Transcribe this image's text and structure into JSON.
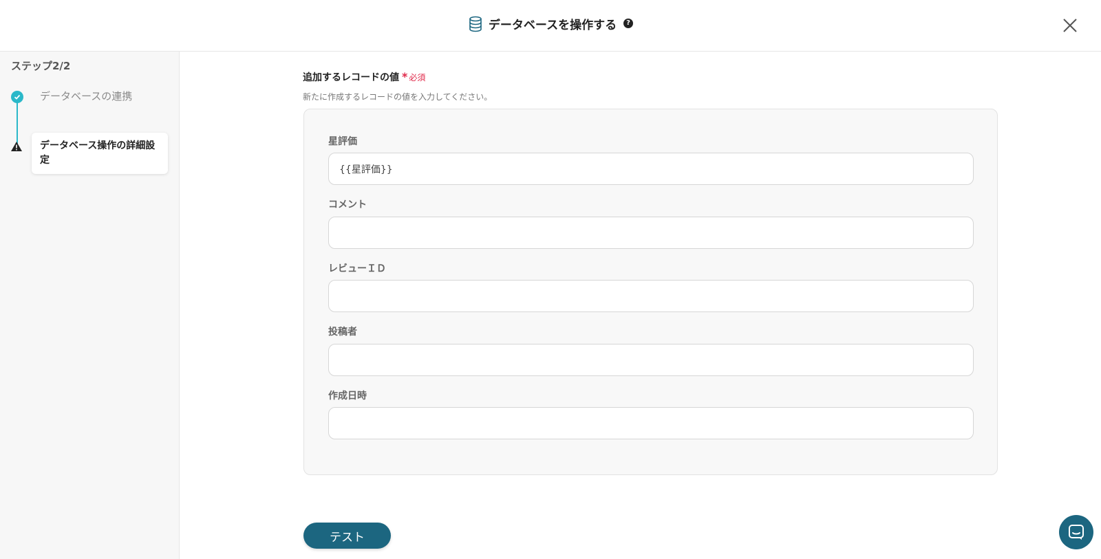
{
  "header": {
    "title": "データベースを操作する",
    "help_glyph": "?"
  },
  "sidebar": {
    "step_label": "ステップ2/2",
    "steps": [
      {
        "label": "データベースの連携",
        "status": "complete"
      },
      {
        "label": "データベース操作の詳細設定",
        "status": "warning"
      }
    ]
  },
  "form": {
    "title": "追加するレコードの値",
    "required_star": "*",
    "required_text": "必須",
    "description": "新たに作成するレコードの値を入力してください。",
    "fields": [
      {
        "label": "星評価",
        "value": "{{星評価}}"
      },
      {
        "label": "コメント",
        "value": ""
      },
      {
        "label": "レビューＩＤ",
        "value": ""
      },
      {
        "label": "投稿者",
        "value": ""
      },
      {
        "label": "作成日時",
        "value": ""
      }
    ]
  },
  "actions": {
    "test_label": "テスト"
  },
  "colors": {
    "accent": "#2bb8c9",
    "primary": "#1c6680",
    "required": "#e0294a"
  }
}
